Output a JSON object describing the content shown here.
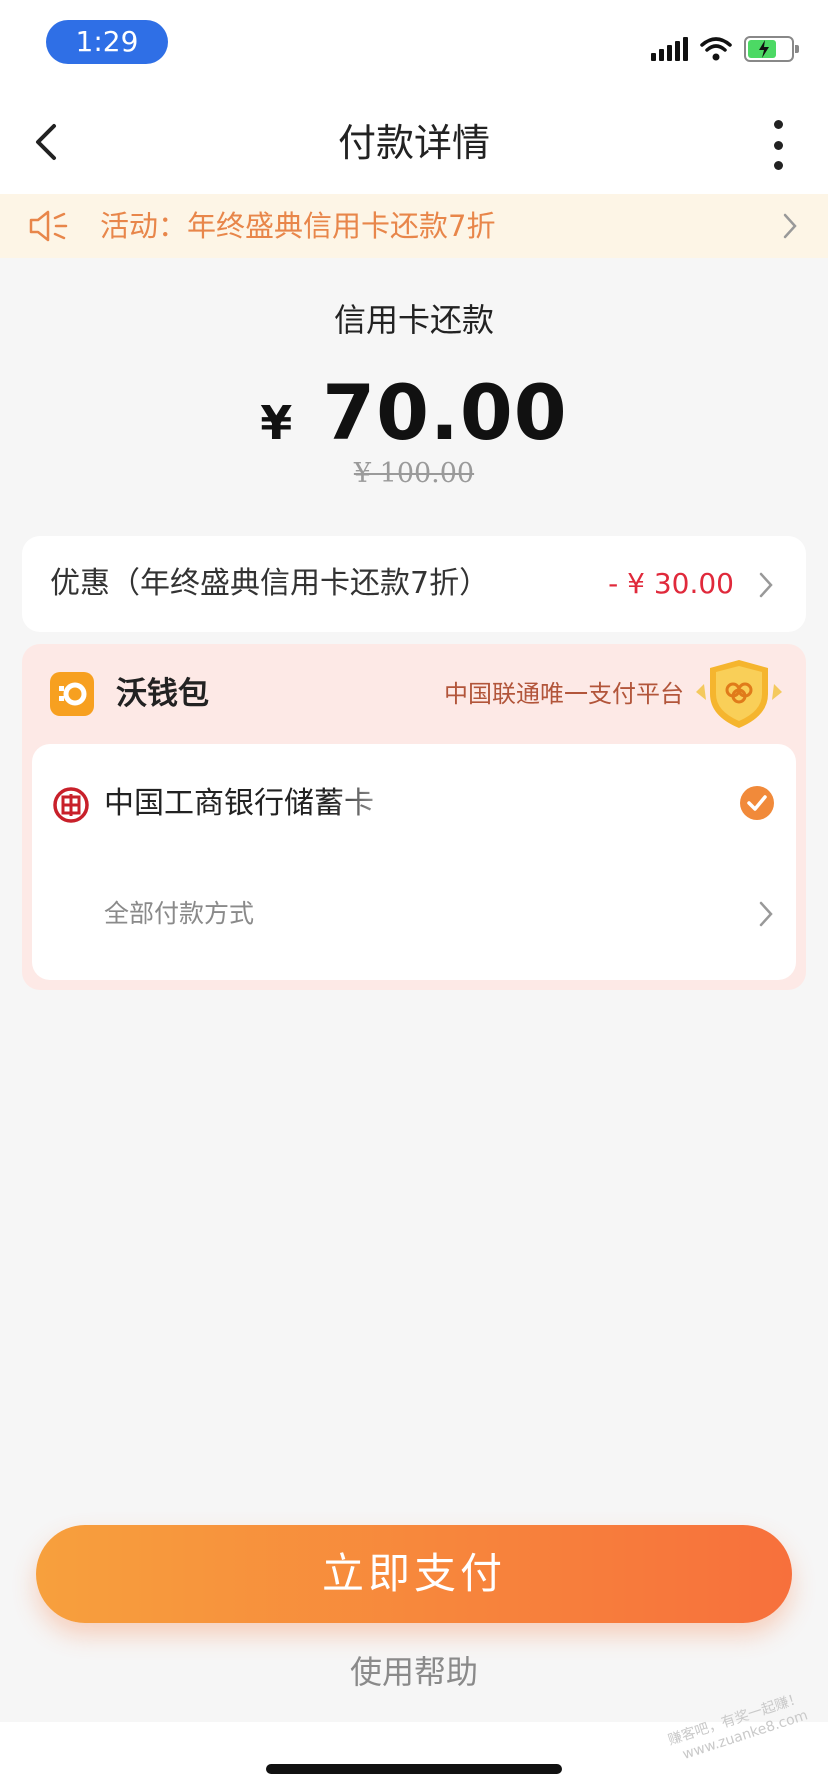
{
  "status_bar": {
    "time": "1:29"
  },
  "header": {
    "title": "付款详情"
  },
  "banner": {
    "text": "活动：年终盛典信用卡还款7折"
  },
  "payment": {
    "subject": "信用卡还款",
    "currency_symbol": "¥",
    "amount": "70.00",
    "original_amount": "¥ 100.00"
  },
  "discount": {
    "label": "优惠（年终盛典信用卡还款7折）",
    "value": "- ¥ 30.00"
  },
  "wallet": {
    "name": "沃钱包",
    "slogan": "中国联通唯一支付平台",
    "bank_name": "中国工商银行储蓄卡",
    "all_methods": "全部付款方式"
  },
  "actions": {
    "pay_label": "立即支付",
    "help_label": "使用帮助"
  },
  "watermark": {
    "line1": "赚客吧，有奖一起赚！",
    "line2": "www.zuanke8.com"
  },
  "colors": {
    "accent": "#f7703c",
    "accent_light": "#f7a03d",
    "discount_red": "#e0293b",
    "banner_text": "#e8864a",
    "status_pill": "#2f6fe6"
  },
  "icons": [
    "back-arrow",
    "more-vertical",
    "speaker-announcement",
    "chevron-right",
    "wallet-logo",
    "shield-badge",
    "icbc-logo",
    "check-circle"
  ]
}
